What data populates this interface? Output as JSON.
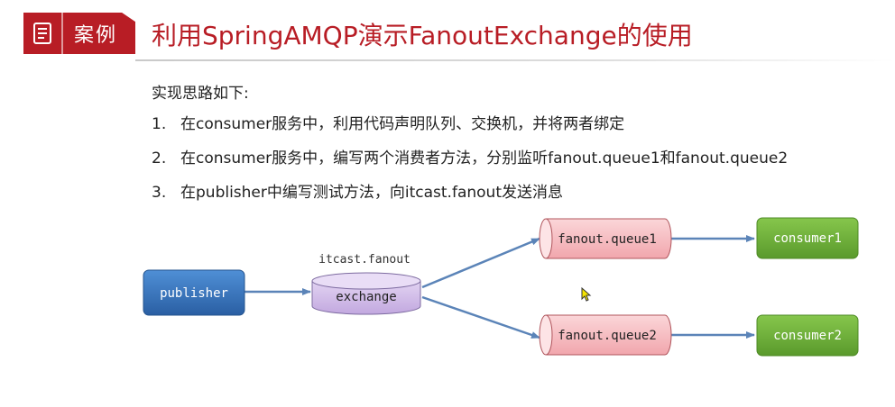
{
  "header": {
    "badge_label": "案例",
    "badge_icon": "document-list-icon",
    "title": "利用SpringAMQP演示FanoutExchange的使用"
  },
  "body": {
    "intro": "实现思路如下:",
    "steps": [
      {
        "num": "1.",
        "text": "在consumer服务中，利用代码声明队列、交换机，并将两者绑定"
      },
      {
        "num": "2.",
        "text": "在consumer服务中，编写两个消费者方法，分别监听fanout.queue1和fanout.queue2"
      },
      {
        "num": "3.",
        "text": "在publisher中编写测试方法，向itcast.fanout发送消息"
      }
    ]
  },
  "diagram": {
    "publisher": "publisher",
    "exchange_name": "itcast.fanout",
    "exchange": "exchange",
    "queue1": "fanout.queue1",
    "queue2": "fanout.queue2",
    "consumer1": "consumer1",
    "consumer2": "consumer2"
  },
  "colors": {
    "accent": "#b81d25",
    "publisher": "#2e6db4",
    "exchange": "#cdb6e6",
    "queue": "#f6b5bb",
    "consumer": "#6fae37",
    "arrow": "#5b84b8"
  }
}
